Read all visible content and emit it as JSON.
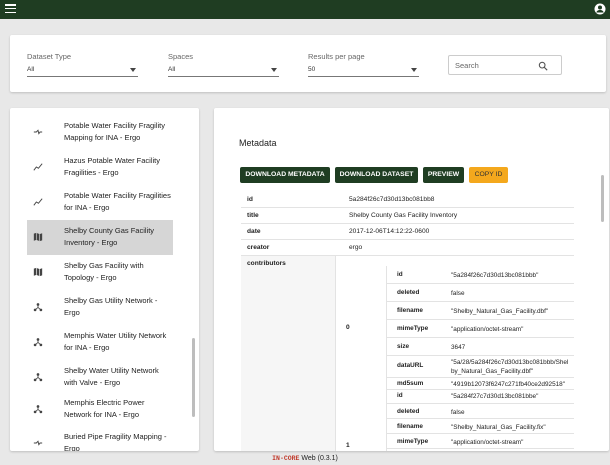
{
  "filters": {
    "dataset_type": {
      "label": "Dataset Type",
      "value": "All"
    },
    "spaces": {
      "label": "Spaces",
      "value": "All"
    },
    "results_per_page": {
      "label": "Results per page",
      "value": "50"
    },
    "search": {
      "placeholder": "Search"
    }
  },
  "datasets": [
    {
      "label": "Potable Water Facility Fragility Mapping for INA - Ergo",
      "icon": "mapping-icon"
    },
    {
      "label": "Hazus Potable Water Facility Fragilities - Ergo",
      "icon": "fragility-curve-icon"
    },
    {
      "label": "Potable Water Facility Fragilities for INA - Ergo",
      "icon": "fragility-curve-icon"
    },
    {
      "label": "Shelby County Gas Facility Inventory - Ergo",
      "icon": "map-icon",
      "selected": true
    },
    {
      "label": "Shelby Gas Facility with Topology - Ergo",
      "icon": "map-icon"
    },
    {
      "label": "Shelby Gas Utility Network - Ergo",
      "icon": "network-icon"
    },
    {
      "label": "Memphis Water Utility Network for INA - Ergo",
      "icon": "network-icon"
    },
    {
      "label": "Shelby Water Utility Network with Valve - Ergo",
      "icon": "network-icon"
    },
    {
      "label": "Memphis Electric Power Network for INA - Ergo",
      "icon": "network-icon"
    },
    {
      "label": "Buried Pipe Fragility Mapping - Ergo",
      "icon": "mapping-icon"
    }
  ],
  "metadata": {
    "title": "Metadata",
    "buttons": {
      "download_metadata": "DOWNLOAD METADATA",
      "download_dataset": "DOWNLOAD DATASET",
      "preview": "PREVIEW",
      "copy_id": "COPY ID"
    },
    "rows": [
      {
        "key": "id",
        "value": "5a284f26c7d30d13bc081bb8"
      },
      {
        "key": "title",
        "value": "Shelby County Gas Facility Inventory"
      },
      {
        "key": "date",
        "value": "2017-12-06T14:12:22-0600"
      },
      {
        "key": "creator",
        "value": "ergo"
      }
    ],
    "contributors_label": "contributors",
    "file_descriptors": [
      {
        "index": "0",
        "rows": [
          {
            "key": "id",
            "value": "\"5a284f26c7d30d13bc081bbb\""
          },
          {
            "key": "deleted",
            "value": "false"
          },
          {
            "key": "filename",
            "value": "\"Shelby_Natural_Gas_Facility.dbf\""
          },
          {
            "key": "mimeType",
            "value": "\"application/octet-stream\""
          },
          {
            "key": "size",
            "value": "3647"
          },
          {
            "key": "dataURL",
            "value": "\"5a/28/5a284f26c7d30d13bc081bbb/Shelby_Natural_Gas_Facility.dbf\""
          },
          {
            "key": "md5sum",
            "value": "\"4919b12073f6247c271fb40ce2d92518\""
          }
        ]
      },
      {
        "index": "1",
        "rows": [
          {
            "key": "id",
            "value": "\"5a284f27c7d30d13bc081bbe\""
          },
          {
            "key": "deleted",
            "value": "false"
          },
          {
            "key": "filename",
            "value": "\"Shelby_Natural_Gas_Facility.fix\""
          },
          {
            "key": "mimeType",
            "value": "\"application/octet-stream\""
          }
        ]
      }
    ]
  },
  "footer": {
    "brand": "IN-CORE",
    "text": "Web (0.3.1)"
  },
  "colors": {
    "appbar": "#1f3d22",
    "primary_button": "#1f3d22",
    "copy_button": "#f4a81d",
    "brand": "#c0392b"
  }
}
